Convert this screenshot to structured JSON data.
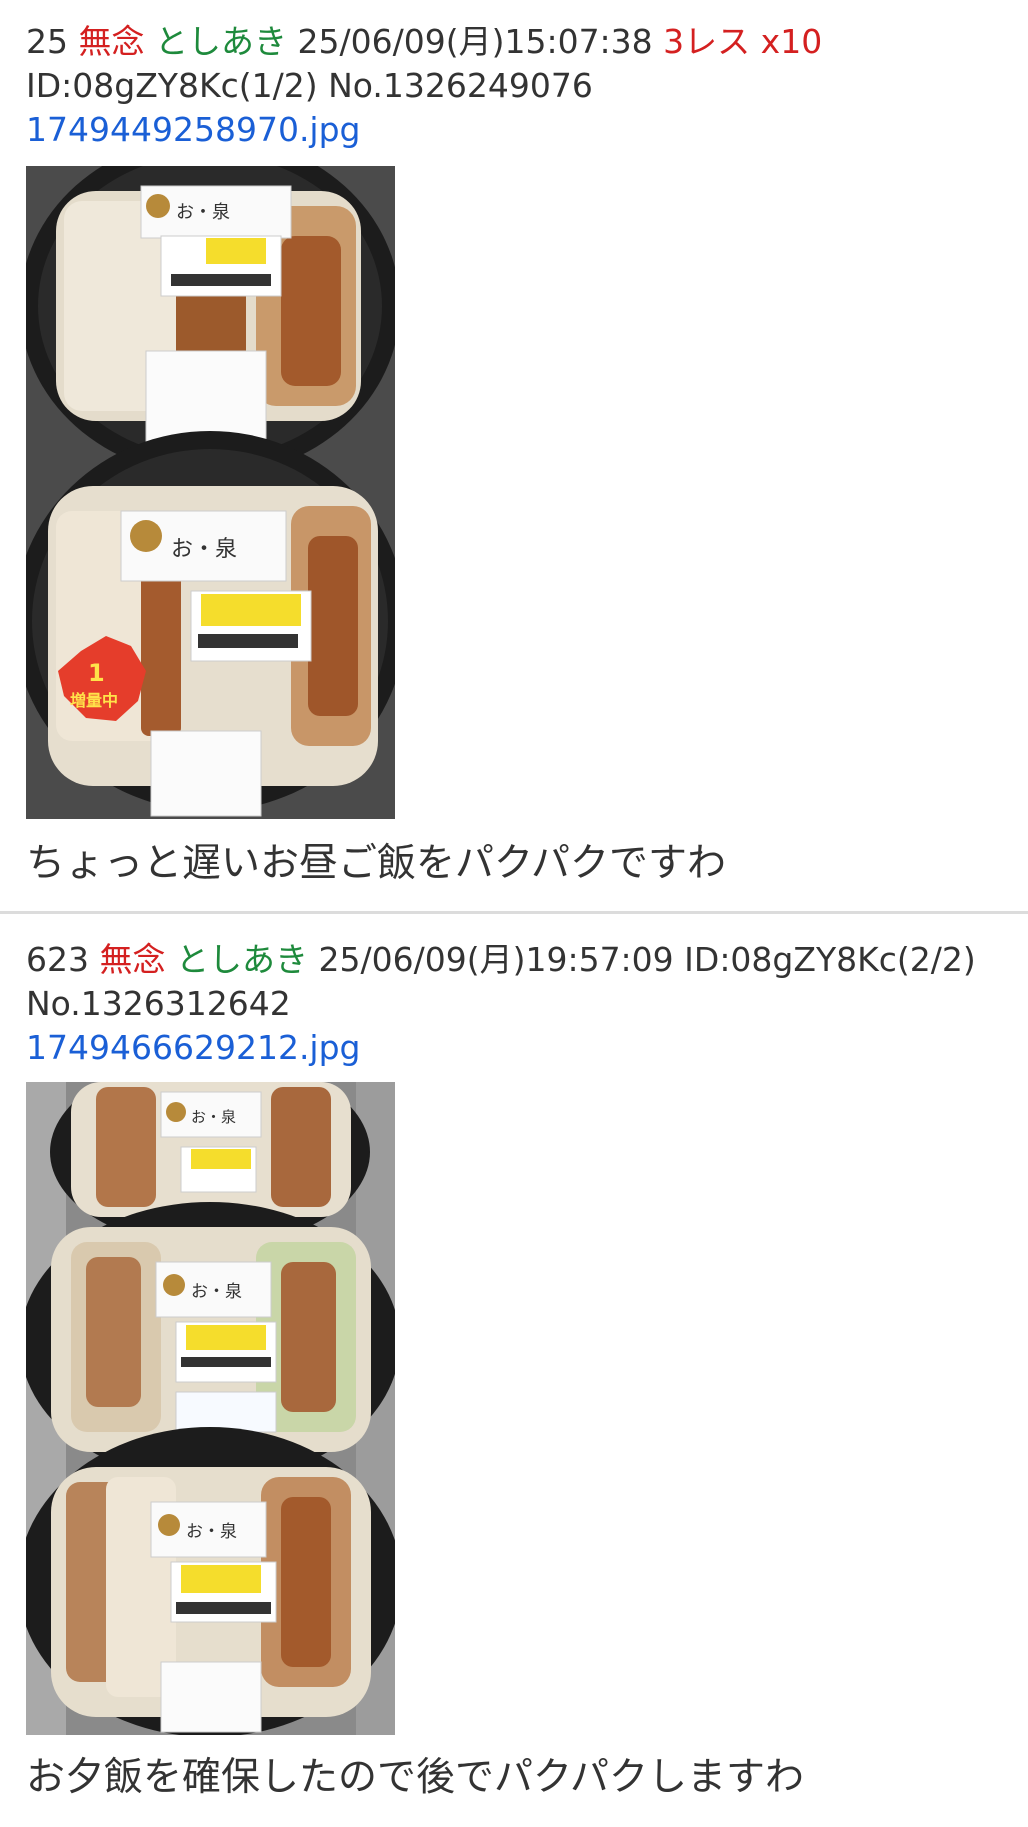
{
  "posts": [
    {
      "number": "25",
      "mail": "無念",
      "name": "としあき",
      "datetime": "25/06/09(月)15:07:38",
      "replies": "3レス",
      "sodane": "x10",
      "id": "ID:08gZY8Kc(1/2)",
      "post_no": "No.1326249076",
      "file": "1749449258970.jpg",
      "label_texts": [
        "お・泉",
        "1",
        "増量中"
      ],
      "comment": "ちょっと遅いお昼ご飯をパクパクですわ"
    },
    {
      "number": "623",
      "mail": "無念",
      "name": "としあき",
      "datetime": "25/06/09(月)19:57:09",
      "id": "ID:08gZY8Kc(2/2)",
      "post_no": "No.1326312642",
      "file": "1749466629212.jpg",
      "label_texts": [
        "お・泉",
        "お・泉",
        "お・泉"
      ],
      "comment": "お夕飯を確保したので後でパクパクしますわ"
    }
  ],
  "colors": {
    "mail": "#d42020",
    "name": "#1e8a3c",
    "link": "#1a5fd6",
    "text": "#333333",
    "divider": "#dcdcdc"
  }
}
